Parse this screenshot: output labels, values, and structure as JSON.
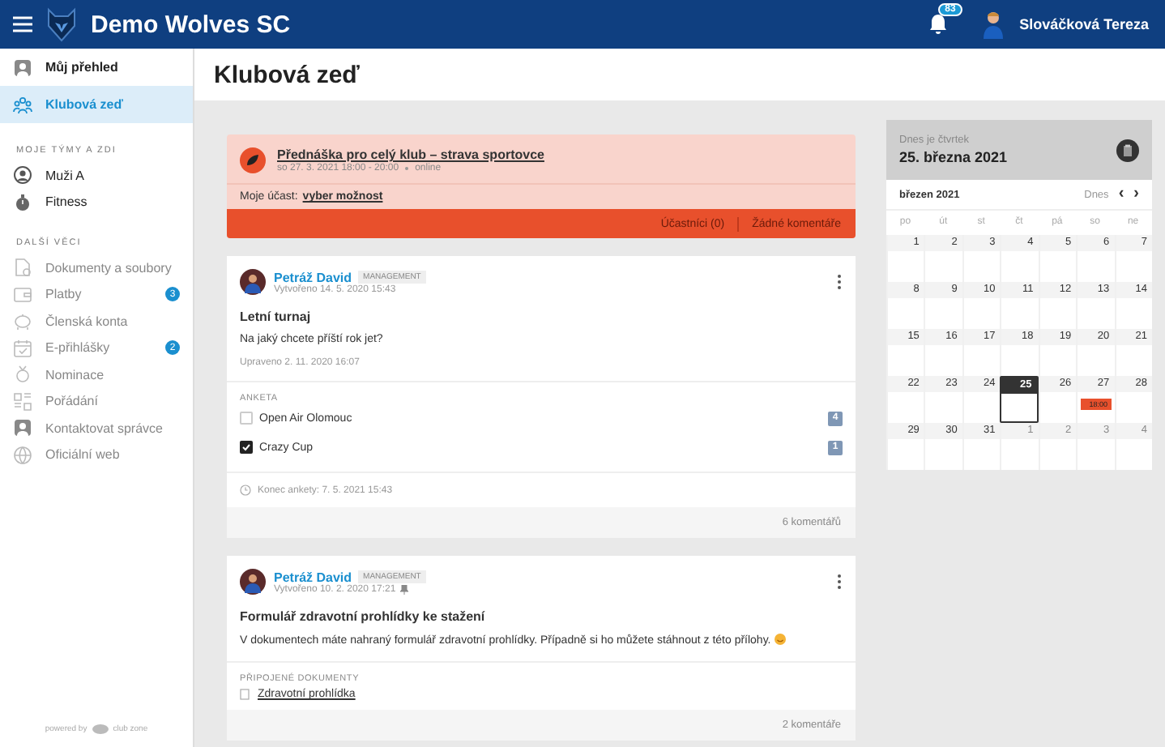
{
  "header": {
    "title": "Demo Wolves SC",
    "notifications": "83",
    "user": "Slováčková Tereza"
  },
  "sidebar": {
    "items": [
      {
        "label": "Můj přehled",
        "kind": "person",
        "selected": false
      },
      {
        "label": "Klubová zeď",
        "kind": "people",
        "selected": true
      }
    ],
    "sections": [
      {
        "title": "MOJE TÝMY A ZDI",
        "items": [
          {
            "label": "Muži A",
            "kind": "team"
          },
          {
            "label": "Fitness",
            "kind": "timer"
          }
        ]
      },
      {
        "title": "DALŠÍ VĚCI",
        "items": [
          {
            "label": "Dokumenty a soubory",
            "kind": "doc"
          },
          {
            "label": "Platby",
            "kind": "wallet",
            "badge": "3"
          },
          {
            "label": "Členská konta",
            "kind": "piggy"
          },
          {
            "label": "E-přihlášky",
            "kind": "calendar",
            "badge": "2"
          },
          {
            "label": "Nominace",
            "kind": "medal"
          },
          {
            "label": "Pořádání",
            "kind": "board"
          },
          {
            "label": "Kontaktovat správce",
            "kind": "person"
          },
          {
            "label": "Oficiální web",
            "kind": "globe"
          }
        ]
      }
    ],
    "footer": {
      "powered": "powered by",
      "brand": "club zone"
    }
  },
  "page": {
    "title": "Klubová zeď"
  },
  "event": {
    "title": "Přednáška pro celý klub – strava sportovce",
    "time": "so 27. 3. 2021 18:00 - 20:00",
    "place": "online",
    "participation_label": "Moje účast:",
    "participation_link": "vyber možnost",
    "participants": "Účastníci (0)",
    "comments": "Žádné komentáře"
  },
  "posts": [
    {
      "author": "Petráž David",
      "role": "MANAGEMENT",
      "created": "Vytvořeno 14. 5. 2020 15:43",
      "pinned": false,
      "title": "Letní turnaj",
      "text": "Na jaký chcete příští rok jet?",
      "edited": "Upraveno 2. 11. 2020 16:07",
      "poll": {
        "title": "ANKETA",
        "options": [
          {
            "label": "Open Air Olomouc",
            "checked": false,
            "votes": "4"
          },
          {
            "label": "Crazy Cup",
            "checked": true,
            "votes": "1"
          }
        ],
        "end": "Konec ankety: 7. 5. 2021 15:43"
      },
      "comments": "6 komentářů"
    },
    {
      "author": "Petráž David",
      "role": "MANAGEMENT",
      "created": "Vytvořeno 10. 2. 2020 17:21",
      "pinned": true,
      "title": "Formulář zdravotní prohlídky ke stažení",
      "text": "V dokumentech máte nahraný formulář zdravotní prohlídky. Případně si ho můžete stáhnout z této přílohy.",
      "attachments": {
        "title": "PŘIPOJENÉ DOKUMENTY",
        "files": [
          "Zdravotní prohlídka"
        ]
      },
      "comments": "2 komentáře"
    }
  ],
  "calendar": {
    "today_label": "Dnes je čtvrtek",
    "today_date": "25. března 2021",
    "month": "březen 2021",
    "today_button": "Dnes",
    "prev": "‹",
    "next": "›",
    "weekdays": [
      "po",
      "út",
      "st",
      "čt",
      "pá",
      "so",
      "ne"
    ],
    "weeks": [
      [
        {
          "day": "1",
          "other_month": false,
          "selected": false
        },
        {
          "day": "2",
          "other_month": false,
          "selected": false
        },
        {
          "day": "3",
          "other_month": false,
          "selected": false
        },
        {
          "day": "4",
          "other_month": false,
          "selected": false
        },
        {
          "day": "5",
          "other_month": false,
          "selected": false
        },
        {
          "day": "6",
          "other_month": false,
          "selected": false
        },
        {
          "day": "7",
          "other_month": false,
          "selected": false
        }
      ],
      [
        {
          "day": "8",
          "other_month": false,
          "selected": false
        },
        {
          "day": "9",
          "other_month": false,
          "selected": false
        },
        {
          "day": "10",
          "other_month": false,
          "selected": false
        },
        {
          "day": "11",
          "other_month": false,
          "selected": false
        },
        {
          "day": "12",
          "other_month": false,
          "selected": false
        },
        {
          "day": "13",
          "other_month": false,
          "selected": false
        },
        {
          "day": "14",
          "other_month": false,
          "selected": false
        }
      ],
      [
        {
          "day": "15",
          "other_month": false,
          "selected": false
        },
        {
          "day": "16",
          "other_month": false,
          "selected": false
        },
        {
          "day": "17",
          "other_month": false,
          "selected": false
        },
        {
          "day": "18",
          "other_month": false,
          "selected": false
        },
        {
          "day": "19",
          "other_month": false,
          "selected": false
        },
        {
          "day": "20",
          "other_month": false,
          "selected": false
        },
        {
          "day": "21",
          "other_month": false,
          "selected": false
        }
      ],
      [
        {
          "day": "22",
          "other_month": false,
          "selected": false
        },
        {
          "day": "23",
          "other_month": false,
          "selected": false
        },
        {
          "day": "24",
          "other_month": false,
          "selected": false
        },
        {
          "day": "25",
          "other_month": false,
          "selected": true
        },
        {
          "day": "26",
          "other_month": false,
          "selected": false
        },
        {
          "day": "27",
          "other_month": false,
          "selected": false,
          "events": [
            {
              "time": "18:00",
              "color": "#e8502c"
            }
          ]
        },
        {
          "day": "28",
          "other_month": false,
          "selected": false
        }
      ],
      [
        {
          "day": "29",
          "other_month": false,
          "selected": false
        },
        {
          "day": "30",
          "other_month": false,
          "selected": false
        },
        {
          "day": "31",
          "other_month": false,
          "selected": false
        },
        {
          "day": "1",
          "other_month": true,
          "selected": false
        },
        {
          "day": "2",
          "other_month": true,
          "selected": false
        },
        {
          "day": "3",
          "other_month": true,
          "selected": false
        },
        {
          "day": "4",
          "other_month": true,
          "selected": false
        }
      ]
    ]
  }
}
